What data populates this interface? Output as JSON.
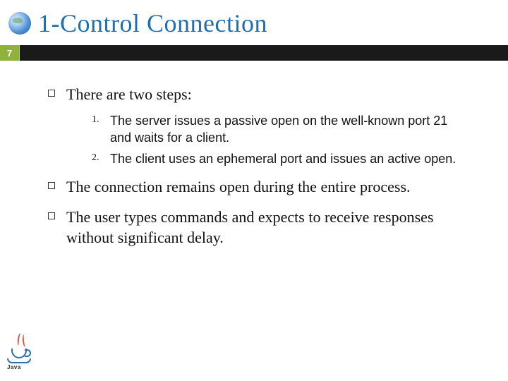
{
  "page_number": "7",
  "title": "1-Control Connection",
  "bullets": {
    "b1": "There are two steps:",
    "b2": "The connection remains open during the entire process.",
    "b3": "The user types commands and expects to receive responses without significant delay."
  },
  "numbered": {
    "n1_label": "1.",
    "n1_text": "The server issues a passive open on the well-known port 21 and waits for a client.",
    "n2_label": "2.",
    "n2_text": "The client uses an ephemeral port and issues an active open."
  },
  "logo_text": "Java"
}
